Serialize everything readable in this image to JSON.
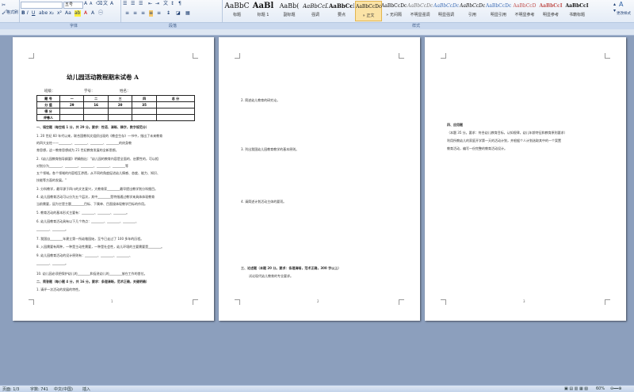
{
  "ribbon": {
    "clipboard_cut": "格式刷",
    "font_size": "五号",
    "change_styles": "更改样式",
    "group_labels": [
      "字体",
      "段落",
      "样式"
    ],
    "styles": [
      {
        "sample": "AaBbC",
        "name": "标题"
      },
      {
        "sample": "AaBl",
        "name": "标题 1"
      },
      {
        "sample": "AaBb(",
        "name": "副标题"
      },
      {
        "sample": "AaBbCcD",
        "name": "强调"
      },
      {
        "sample": "AaBbCcD",
        "name": "要点"
      },
      {
        "sample": "AaBbCcDc",
        "name": "» 正文"
      },
      {
        "sample": "AaBbCcDc",
        "name": "» 无间隔"
      },
      {
        "sample": "AaBbCcDc",
        "name": "不明显强调"
      },
      {
        "sample": "AaBbCcDc",
        "name": "明显强调"
      },
      {
        "sample": "AaBbCcDc",
        "name": "引用"
      },
      {
        "sample": "AaBbCcDc",
        "name": "明显引用"
      },
      {
        "sample": "AaBbCcD",
        "name": "不明显参考"
      },
      {
        "sample": "AaBbCcI",
        "name": "明显参考"
      },
      {
        "sample": "AaBbCcI",
        "name": "书籍标题"
      }
    ]
  },
  "page1": {
    "title": "幼儿园活动教程期末试卷 A",
    "class_label": "班级：",
    "id_label": "学号：",
    "name_label": "姓名：",
    "table": {
      "rows": [
        [
          "题 号",
          "一",
          "二",
          "三",
          "四",
          "总 分"
        ],
        [
          "分 值",
          "29",
          "16",
          "20",
          "35",
          ""
        ],
        [
          "得 分",
          "",
          "",
          "",
          "",
          ""
        ],
        [
          "评卷人",
          "",
          "",
          "",
          "",
          ""
        ]
      ]
    },
    "lines": [
      "一、填空题（每空格 1 分，共 29 分。要求：性语、清晰、精字，数字规范分）",
      "1. 20 世纪 60 年代以来，联合国教科文组织出现的《教会生存》一书中，指出了未来教育",
      "的四大支柱——________、________、________、________的终身教",
      "育思想，这一教育思想成为 21 世纪教育发展的全新思想。",
      "2.《幼儿园教育指导纲要》明确指出：“幼儿园的教育内容是全面的、启蒙性的，可以相",
      "对划分为________、________、________、________、________等",
      "五个领域。各个领域的内容相互渗透，从不同的角度促进幼儿情感、态度、能力、知识、",
      "技能等方面的发展。”",
      "3. 分科教学，最早源于四川的文艺复兴，大教育家________最早提出教学划分科细目。",
      "4. 幼儿园教育活动可以分为五个层次，其中________是特指通过教学来具体体现教育",
      "当前需要，因为它是主题________目标、下属单、目直接体现教学目标的作用。",
      "5. 教育活动的基本形式主要有：________、________、________。",
      "6. 幼儿园教育活动具有以下几个特点：________、________、________、",
      "________、________。",
      "7. 我国自________年建立第一所幼稚园始，至今已走过了 100 多年的历程。",
      "8. 入园需要有两种，一种是主动性需要，一种是社会性，幼儿环境的主要需要是________。",
      "9. 幼儿园教育活动的设计原则有：________、________、________、",
      "________、________。",
      "10. 幼儿园必须把保护幼儿的________和促进幼儿的________放在工作的首位。",
      "二、简答题（每小题 4 分，共 16 分。要求：条理清晰，范术正确，关键明确）",
      "1. 请评一次活动的发展的特性。"
    ],
    "page_number": "1"
  },
  "page2": {
    "lines": [
      "2. 简述幼儿教育的研究论。",
      "3. 列出我国幼儿园教育教学的基本原则。",
      "4. 请简述计划活动主体的要项。",
      "三、论述题（本题 20 分。要求：条理清晰，范术正确，300 字以上）",
      "试论现代幼儿教育的专业要求。"
    ],
    "page_number": "2"
  },
  "page3": {
    "lines": [
      "四、应用题",
      "（本题 35 分。要求：符合幼儿教育目标，认知规律，幼儿年龄特征和教育原则要求）",
      "    利用所教幼儿的家庭开学第一天的活动计划，并根据个人计划选取其中的一个案置",
      "教育活动，编写一份完整的教育活动设计。"
    ],
    "page_number": "3"
  },
  "status": {
    "page": "页面: 1/3",
    "words": "字数: 741",
    "lang": "中文(中国)",
    "mode": "插入",
    "zoom": "60%"
  }
}
